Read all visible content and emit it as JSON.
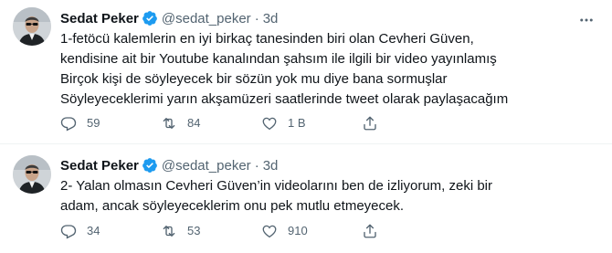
{
  "colors": {
    "text": "#0f1419",
    "muted": "#536471",
    "verified": "#1d9bf0",
    "divider": "#eff3f4"
  },
  "tweets": [
    {
      "author": {
        "name": "Sedat Peker",
        "handle": "@sedat_peker",
        "verified": true,
        "avatar_icon": "profile-avatar"
      },
      "separator": "·",
      "time": "3d",
      "text": "1-fetöcü kalemlerin en iyi birkaç tanesinden biri olan Cevheri Güven,\nkendisine ait bir Youtube kanalından şahsım ile ilgili bir video yayınlamış\nBirçok kişi de söyleyecek bir sözün yok mu diye bana sormuşlar\nSöyleyeceklerimi yarın akşamüzeri saatlerinde tweet olarak paylaşacağım",
      "replies": "59",
      "retweets": "84",
      "likes": "1 B",
      "has_more_menu": true
    },
    {
      "author": {
        "name": "Sedat Peker",
        "handle": "@sedat_peker",
        "verified": true,
        "avatar_icon": "profile-avatar"
      },
      "separator": "·",
      "time": "3d",
      "text": "2- Yalan olmasın Cevheri Güven’in videolarını ben de izliyorum, zeki bir\nadam, ancak söyleyeceklerim onu pek mutlu etmeyecek.",
      "replies": "34",
      "retweets": "53",
      "likes": "910",
      "has_more_menu": false
    }
  ]
}
